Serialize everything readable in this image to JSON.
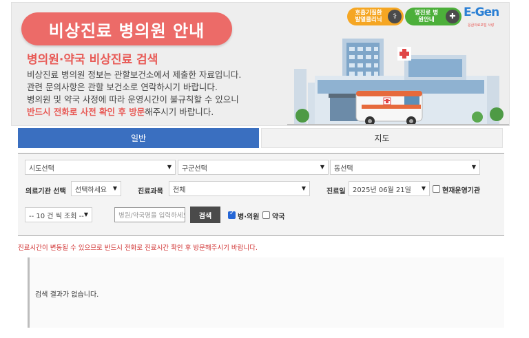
{
  "banner": {
    "title": "비상진료 병의원 안내",
    "subtitle": "병의원·약국 비상진료 검색",
    "lines": [
      "비상진료 병의원 정보는 관할보건소에서 제출한 자료입니다.",
      "관련 문의사항은 관할 보건소로 연락하시기 바랍니다.",
      "병의원 및 약국 사정에 따라 운영시간이 불규칙할 수 있으니"
    ],
    "last_line_highlight": "반드시 전화로 사전 확인 후 방문",
    "last_line_rest": "해주시기 바랍니다.",
    "badge_orange": "호흡기질환 발열클리닉",
    "badge_green": "명진료 병원안내",
    "logo_text": "E-Gen",
    "logo_sub": "응급의료포털 사랑"
  },
  "tabs": {
    "general": "일반",
    "map": "지도"
  },
  "form": {
    "sido": "시도선택",
    "gugun": "구군선택",
    "dong": "동선택",
    "institution_label": "의료기관 선택",
    "institution_value": "선택하세요",
    "dept_label": "진료과목",
    "dept_value": "전체",
    "date_label": "진료일",
    "date_value": "2025년 06월 21일",
    "current_open_label": "현재운영기관",
    "per_page": "-- 10 건 씩 조회 --",
    "search_placeholder": "병원/약국명을 입력하세요",
    "search_button": "검색",
    "hospital_label": "병·의원",
    "pharmacy_label": "약국"
  },
  "notice": "진료시간이 변동될 수 있으므로 반드시 전화로 진료시간 확인 후 방문해주시기 바랍니다.",
  "result": {
    "empty_message": "검색 결과가 없습니다."
  },
  "colors": {
    "accent_blue": "#3a6fc0",
    "banner_red": "#ec6b68",
    "notice_red": "#d03030"
  }
}
